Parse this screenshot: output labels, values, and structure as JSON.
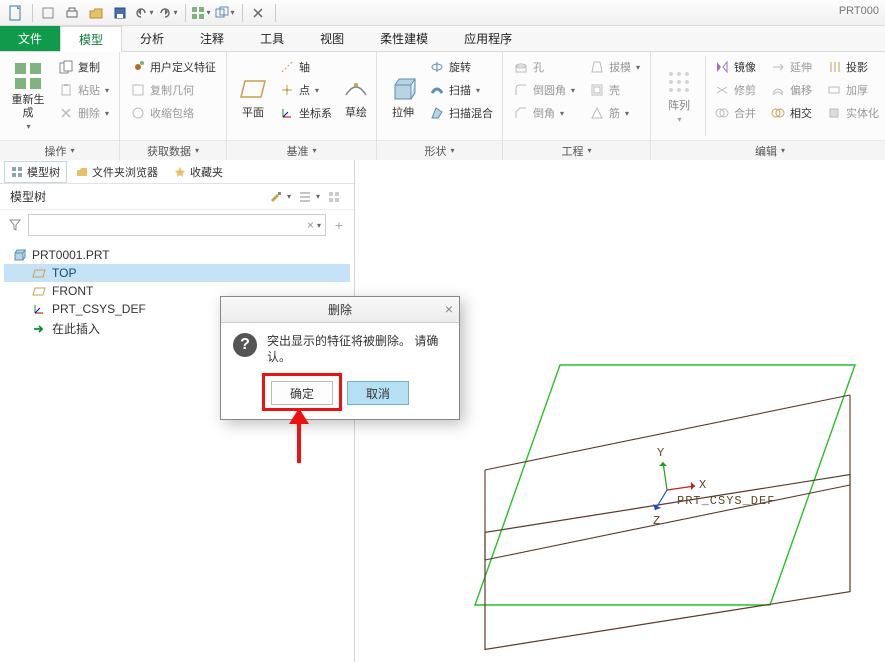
{
  "doc_name": "PRT000",
  "tabs": {
    "file": "文件",
    "model": "模型",
    "analysis": "分析",
    "annotate": "注释",
    "tool": "工具",
    "view": "视图",
    "flex": "柔性建模",
    "app": "应用程序"
  },
  "ribbon": {
    "regen": "重新生成",
    "copy": "复制",
    "paste": "粘贴",
    "delete": "删除",
    "udf": "用户定义特征",
    "copygeom": "复制几何",
    "shrink": "收缩包络",
    "plane": "平面",
    "axis": "轴",
    "point": "点",
    "csys": "坐标系",
    "sketch": "草绘",
    "extrude": "拉伸",
    "revolve": "旋转",
    "sweep": "扫描",
    "swblend": "扫描混合",
    "hole": "孔",
    "round": "倒圆角",
    "chamfer": "倒角",
    "draft": "拔模",
    "shell": "壳",
    "rib": "筋",
    "pattern": "阵列",
    "mirror": "镜像",
    "trim": "修剪",
    "merge": "合并",
    "extend": "延伸",
    "offset": "偏移",
    "intersect": "相交",
    "project": "投影",
    "thicken": "加厚",
    "solidify": "实体化",
    "g_operate": "操作",
    "g_data": "获取数据",
    "g_datum": "基准",
    "g_shape": "形状",
    "g_eng": "工程",
    "g_edit": "编辑"
  },
  "panel": {
    "t_tree": "模型树",
    "t_folder": "文件夹浏览器",
    "t_fav": "收藏夹",
    "title": "模型树",
    "root": "PRT0001.PRT",
    "top": "TOP",
    "front": "FRONT",
    "csys": "PRT_CSYS_DEF",
    "insert": "在此插入"
  },
  "dialog": {
    "title": "删除",
    "msg": "突出显示的特征将被删除。 请确认。",
    "ok": "确定",
    "cancel": "取消"
  },
  "axes": {
    "x": "X",
    "y": "Y",
    "z": "Z",
    "csys": "PRT_CSYS_DEF"
  }
}
